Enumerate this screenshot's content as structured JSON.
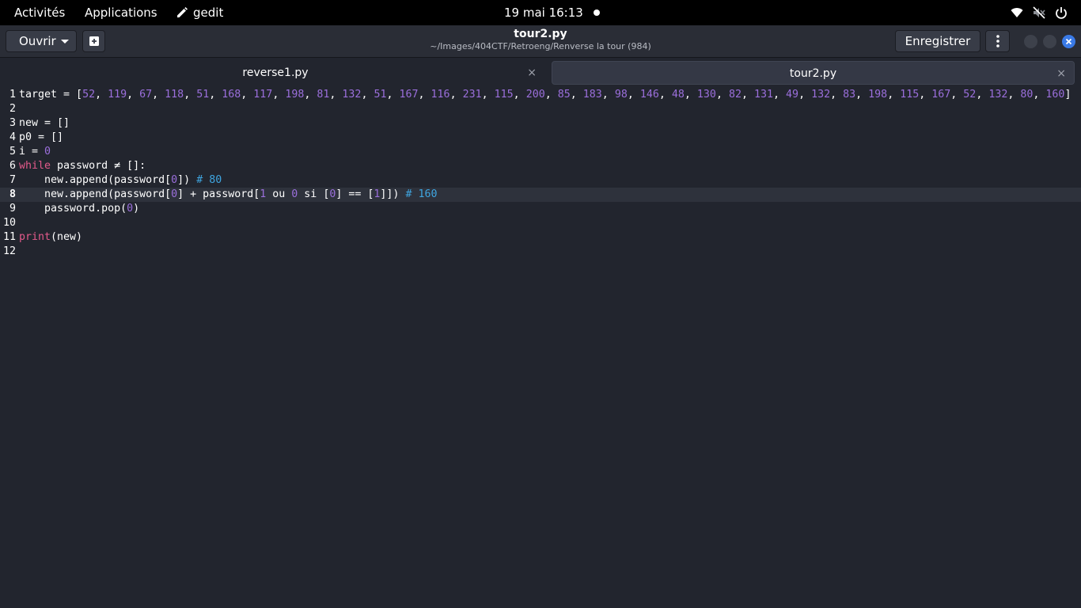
{
  "topbar": {
    "activities": "Activités",
    "applications": "Applications",
    "app_name": "gedit",
    "clock": "19 mai  16:13",
    "icons": [
      "pencil-icon",
      "wifi-icon",
      "sound-muted-icon",
      "power-icon"
    ]
  },
  "headerbar": {
    "open_label": "Ouvrir",
    "title": "tour2.py",
    "subtitle": "~/Images/404CTF/Retroeng/Renverse la tour (984)",
    "save_label": "Enregistrer",
    "icons": [
      "new-document-icon",
      "kebab-menu-icon",
      "minimize-icon",
      "maximize-icon",
      "close-icon"
    ]
  },
  "tabs": [
    {
      "label": "reverse1.py",
      "active": false,
      "close": "×"
    },
    {
      "label": "tour2.py",
      "active": true,
      "close": "×"
    }
  ],
  "editor": {
    "current_line": 8,
    "colors": {
      "keyword": "#e35a8b",
      "number": "#9b6fdc",
      "comment": "#3fa5e0",
      "text": "#ffffff"
    },
    "lines": [
      {
        "n": "1",
        "tokens": [
          [
            "t",
            "target = ["
          ],
          [
            "n",
            "52"
          ],
          [
            "t",
            ", "
          ],
          [
            "n",
            "119"
          ],
          [
            "t",
            ", "
          ],
          [
            "n",
            "67"
          ],
          [
            "t",
            ", "
          ],
          [
            "n",
            "118"
          ],
          [
            "t",
            ", "
          ],
          [
            "n",
            "51"
          ],
          [
            "t",
            ", "
          ],
          [
            "n",
            "168"
          ],
          [
            "t",
            ", "
          ],
          [
            "n",
            "117"
          ],
          [
            "t",
            ", "
          ],
          [
            "n",
            "198"
          ],
          [
            "t",
            ", "
          ],
          [
            "n",
            "81"
          ],
          [
            "t",
            ", "
          ],
          [
            "n",
            "132"
          ],
          [
            "t",
            ", "
          ],
          [
            "n",
            "51"
          ],
          [
            "t",
            ", "
          ],
          [
            "n",
            "167"
          ],
          [
            "t",
            ", "
          ],
          [
            "n",
            "116"
          ],
          [
            "t",
            ", "
          ],
          [
            "n",
            "231"
          ],
          [
            "t",
            ", "
          ],
          [
            "n",
            "115"
          ],
          [
            "t",
            ", "
          ],
          [
            "n",
            "200"
          ],
          [
            "t",
            ", "
          ],
          [
            "n",
            "85"
          ],
          [
            "t",
            ", "
          ],
          [
            "n",
            "183"
          ],
          [
            "t",
            ", "
          ],
          [
            "n",
            "98"
          ],
          [
            "t",
            ", "
          ],
          [
            "n",
            "146"
          ],
          [
            "t",
            ", "
          ],
          [
            "n",
            "48"
          ],
          [
            "t",
            ", "
          ],
          [
            "n",
            "130"
          ],
          [
            "t",
            ", "
          ],
          [
            "n",
            "82"
          ],
          [
            "t",
            ", "
          ],
          [
            "n",
            "131"
          ],
          [
            "t",
            ", "
          ],
          [
            "n",
            "49"
          ],
          [
            "t",
            ", "
          ],
          [
            "n",
            "132"
          ],
          [
            "t",
            ", "
          ],
          [
            "n",
            "83"
          ],
          [
            "t",
            ", "
          ],
          [
            "n",
            "198"
          ],
          [
            "t",
            ", "
          ],
          [
            "n",
            "115"
          ],
          [
            "t",
            ", "
          ],
          [
            "n",
            "167"
          ],
          [
            "t",
            ", "
          ],
          [
            "n",
            "52"
          ],
          [
            "t",
            ", "
          ],
          [
            "n",
            "132"
          ],
          [
            "t",
            ", "
          ],
          [
            "n",
            "80"
          ],
          [
            "t",
            ", "
          ],
          [
            "n",
            "160"
          ],
          [
            "t",
            "]"
          ]
        ]
      },
      {
        "n": "2",
        "tokens": []
      },
      {
        "n": "3",
        "tokens": [
          [
            "t",
            "new = []"
          ]
        ]
      },
      {
        "n": "4",
        "tokens": [
          [
            "t",
            "p0 = []"
          ]
        ]
      },
      {
        "n": "5",
        "tokens": [
          [
            "t",
            "i = "
          ],
          [
            "n",
            "0"
          ]
        ]
      },
      {
        "n": "6",
        "tokens": [
          [
            "k",
            "while"
          ],
          [
            "t",
            " password ≠ []:"
          ]
        ]
      },
      {
        "n": "7",
        "tokens": [
          [
            "t",
            "    new.append(password["
          ],
          [
            "n",
            "0"
          ],
          [
            "t",
            "]) "
          ],
          [
            "c",
            "# 80"
          ]
        ]
      },
      {
        "n": "8",
        "tokens": [
          [
            "t",
            "    new.append(password["
          ],
          [
            "n",
            "0"
          ],
          [
            "t",
            "] + password["
          ],
          [
            "n",
            "1"
          ],
          [
            "t",
            " ou "
          ],
          [
            "n",
            "0"
          ],
          [
            "t",
            " si ["
          ],
          [
            "n",
            "0"
          ],
          [
            "t",
            "] == ["
          ],
          [
            "n",
            "1"
          ],
          [
            "t",
            "]]) "
          ],
          [
            "c",
            "# 160"
          ]
        ]
      },
      {
        "n": "9",
        "tokens": [
          [
            "t",
            "    password.pop("
          ],
          [
            "n",
            "0"
          ],
          [
            "t",
            ")"
          ]
        ]
      },
      {
        "n": "10",
        "tokens": []
      },
      {
        "n": "11",
        "tokens": [
          [
            "f",
            "print"
          ],
          [
            "t",
            "(new)"
          ]
        ]
      },
      {
        "n": "12",
        "tokens": []
      }
    ]
  }
}
